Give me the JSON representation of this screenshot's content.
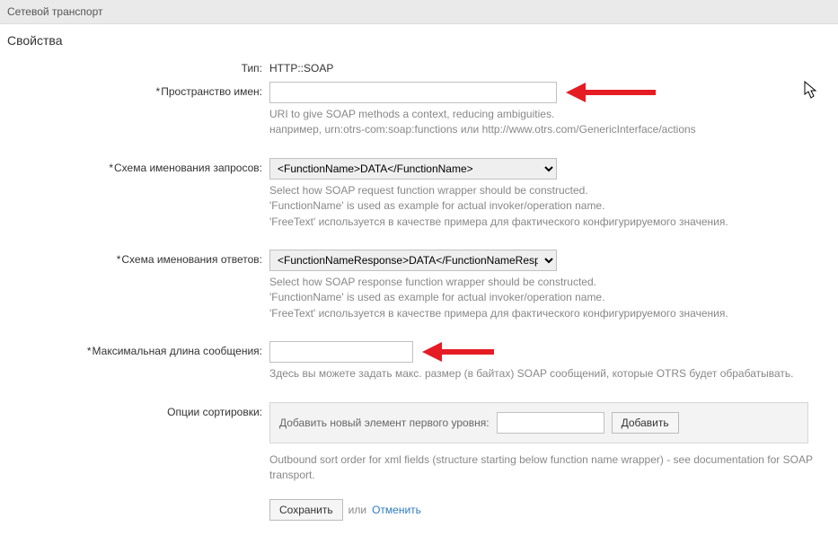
{
  "header": {
    "title": "Сетевой транспорт"
  },
  "section": {
    "title": "Свойства"
  },
  "fields": {
    "type": {
      "label": "Тип:",
      "value": "HTTP::SOAP"
    },
    "namespace": {
      "label": "Пространство имен:",
      "value": "",
      "hint1": "URI to give SOAP methods a context, reducing ambiguities.",
      "hint2": "например, urn:otrs-com:soap:functions или http://www.otrs.com/GenericInterface/actions"
    },
    "reqScheme": {
      "label": "Схема именования запросов:",
      "value": "<FunctionName>DATA</FunctionName>",
      "hint1": "Select how SOAP request function wrapper should be constructed.",
      "hint2": "'FunctionName' is used as example for actual invoker/operation name.",
      "hint3": "'FreeText' используется в качестве примера для фактического конфигурируемого значения."
    },
    "resScheme": {
      "label": "Схема именования ответов:",
      "value": "<FunctionNameResponse>DATA</FunctionNameResponse>",
      "hint1": "Select how SOAP response function wrapper should be constructed.",
      "hint2": "'FunctionName' is used as example for actual invoker/operation name.",
      "hint3": "'FreeText' используется в качестве примера для фактического конфигурируемого значения."
    },
    "maxLen": {
      "label": "Максимальная длина сообщения:",
      "value": "",
      "hint": "Здесь вы можете задать макс. размер (в байтах) SOAP сообщений, которые OTRS будет обрабатывать."
    },
    "sortOpts": {
      "label": "Опции сортировки:",
      "boxLabel": "Добавить новый элемент первого уровня:",
      "addBtn": "Добавить",
      "hint": "Outbound sort order for xml fields (structure starting below function name wrapper) - see documentation for SOAP transport."
    }
  },
  "actions": {
    "save": "Сохранить",
    "or": "или",
    "cancel": "Отменить"
  }
}
